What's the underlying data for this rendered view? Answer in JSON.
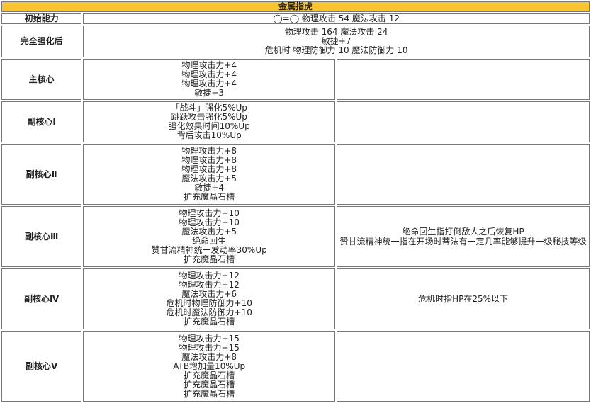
{
  "title": "金属指虎",
  "initial": {
    "label": "初始能力",
    "value": "◯=◯ 物理攻击 54 魔法攻击 12"
  },
  "full": {
    "label": "完全强化后",
    "lines": [
      "物理攻击 164 魔法攻击 24",
      "敏捷+7",
      "危机时 物理防御力 10 魔法防御力 10"
    ]
  },
  "rows": [
    {
      "label": "主核心",
      "lines": [
        "物理攻击力+4",
        "物理攻击力+4",
        "物理攻击力+4",
        "敏捷+3"
      ],
      "notes": []
    },
    {
      "label": "副核心Ⅰ",
      "lines": [
        "「战斗」强化5%Up",
        "跳跃攻击强化5%Up",
        "强化效果时间10%Up",
        "背后攻击10%Up"
      ],
      "notes": []
    },
    {
      "label": "副核心Ⅱ",
      "lines": [
        "物理攻击力+8",
        "物理攻击力+8",
        "物理攻击力+8",
        "魔法攻击力+5",
        "敏捷+4",
        "扩充魔晶石槽"
      ],
      "notes": []
    },
    {
      "label": "副核心Ⅲ",
      "lines": [
        "物理攻击力+10",
        "物理攻击力+10",
        "魔法攻击力+5",
        "绝命回生",
        "赞甘流精神统一发动率30%Up",
        "扩充魔晶石槽"
      ],
      "notes": [
        "绝命回生指打倒敌人之后恢复HP",
        "赞甘流精神统一指在开场时蒂法有一定几率能够提升一级秘技等级"
      ]
    },
    {
      "label": "副核心Ⅳ",
      "lines": [
        "物理攻击力+12",
        "物理攻击力+12",
        "魔法攻击力+6",
        "危机时物理防御力+10",
        "危机时魔法防御力+10",
        "扩充魔晶石槽"
      ],
      "notes": [
        "危机时指HP在25%以下"
      ]
    },
    {
      "label": "副核心Ⅴ",
      "lines": [
        "物理攻击力+15",
        "物理攻击力+15",
        "魔法攻击力+8",
        "ATB增加量10%Up",
        "扩充魔晶石槽",
        "扩充魔晶石槽",
        "扩充魔晶石槽"
      ],
      "notes": []
    }
  ]
}
